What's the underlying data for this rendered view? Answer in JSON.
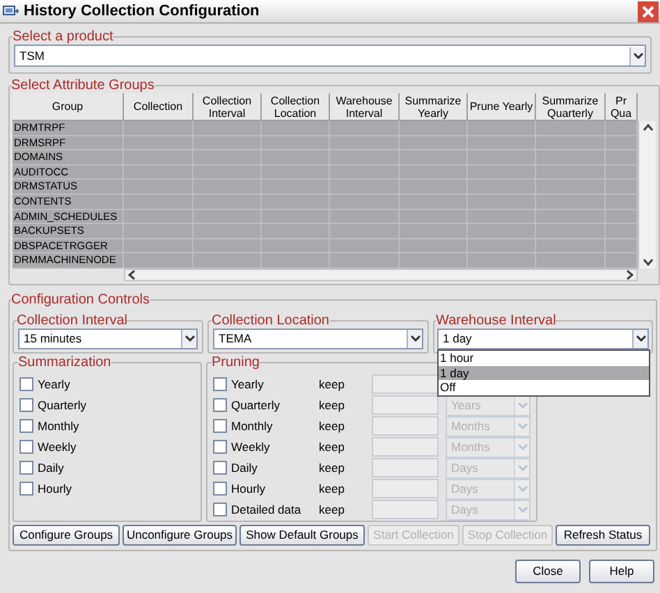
{
  "window": {
    "title": "History Collection Configuration"
  },
  "product": {
    "label": "Select a product",
    "value": "TSM"
  },
  "attribute_groups": {
    "label": "Select Attribute Groups",
    "columns": [
      "Group",
      "Collection",
      "Collection Interval",
      "Collection Location",
      "Warehouse Interval",
      "Summarize Yearly",
      "Prune Yearly",
      "Summarize Quarterly",
      "Pr Qua"
    ],
    "rows": [
      "DRMTRPF",
      "DRMSRPF",
      "DOMAINS",
      "AUDITOCC",
      "DRMSTATUS",
      "CONTENTS",
      "ADMIN_SCHEDULES",
      "BACKUPSETS",
      "DBSPACETRGGER",
      "DRMMACHINENODE"
    ]
  },
  "config": {
    "label": "Configuration Controls",
    "collection_interval": {
      "label": "Collection Interval",
      "value": "15 minutes"
    },
    "collection_location": {
      "label": "Collection Location",
      "value": "TEMA"
    },
    "warehouse_interval": {
      "label": "Warehouse Interval",
      "value": "1 day",
      "expanded": true,
      "options": [
        {
          "label": "1 hour",
          "selected": false
        },
        {
          "label": "1 day",
          "selected": true
        },
        {
          "label": "Off",
          "selected": false
        }
      ]
    },
    "summarization": {
      "label": "Summarization",
      "items": [
        {
          "label": "Yearly",
          "checked": false
        },
        {
          "label": "Quarterly",
          "checked": false
        },
        {
          "label": "Monthly",
          "checked": false
        },
        {
          "label": "Weekly",
          "checked": false
        },
        {
          "label": "Daily",
          "checked": false
        },
        {
          "label": "Hourly",
          "checked": false
        }
      ]
    },
    "pruning": {
      "label": "Pruning",
      "items": [
        {
          "label": "Yearly",
          "checked": false,
          "keep": "keep"
        },
        {
          "label": "Quarterly",
          "checked": false,
          "keep": "keep",
          "unit": "Years"
        },
        {
          "label": "Monthly",
          "checked": false,
          "keep": "keep",
          "unit": "Months"
        },
        {
          "label": "Weekly",
          "checked": false,
          "keep": "keep",
          "unit": "Months"
        },
        {
          "label": "Daily",
          "checked": false,
          "keep": "keep",
          "unit": "Days"
        },
        {
          "label": "Hourly",
          "checked": false,
          "keep": "keep",
          "unit": "Days"
        },
        {
          "label": "Detailed data",
          "checked": false,
          "keep": "keep",
          "unit": "Days"
        }
      ]
    }
  },
  "buttons": [
    {
      "label": "Configure Groups",
      "disabled": false
    },
    {
      "label": "Unconfigure Groups",
      "disabled": false
    },
    {
      "label": "Show Default Groups",
      "disabled": false
    },
    {
      "label": "Start Collection",
      "disabled": true
    },
    {
      "label": "Stop Collection",
      "disabled": true
    },
    {
      "label": "Refresh Status",
      "disabled": false
    }
  ],
  "footer_buttons": [
    {
      "label": "Close"
    },
    {
      "label": "Help"
    }
  ]
}
